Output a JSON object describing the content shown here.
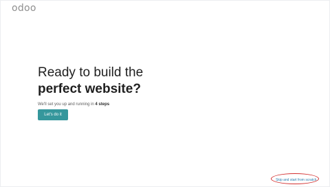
{
  "brand": {
    "logo_text": "odoo"
  },
  "hero": {
    "title_line1": "Ready to build the",
    "title_line2": "perfect website?",
    "subtitle_prefix": "We'll set you up and running in ",
    "subtitle_bold": "4 steps"
  },
  "actions": {
    "start_label": "Let's do it",
    "skip_label": "Skip and start from scratch"
  },
  "colors": {
    "primary_button": "#35979c",
    "link": "#2a7fb0",
    "annotation_circle": "#d32f2f"
  }
}
